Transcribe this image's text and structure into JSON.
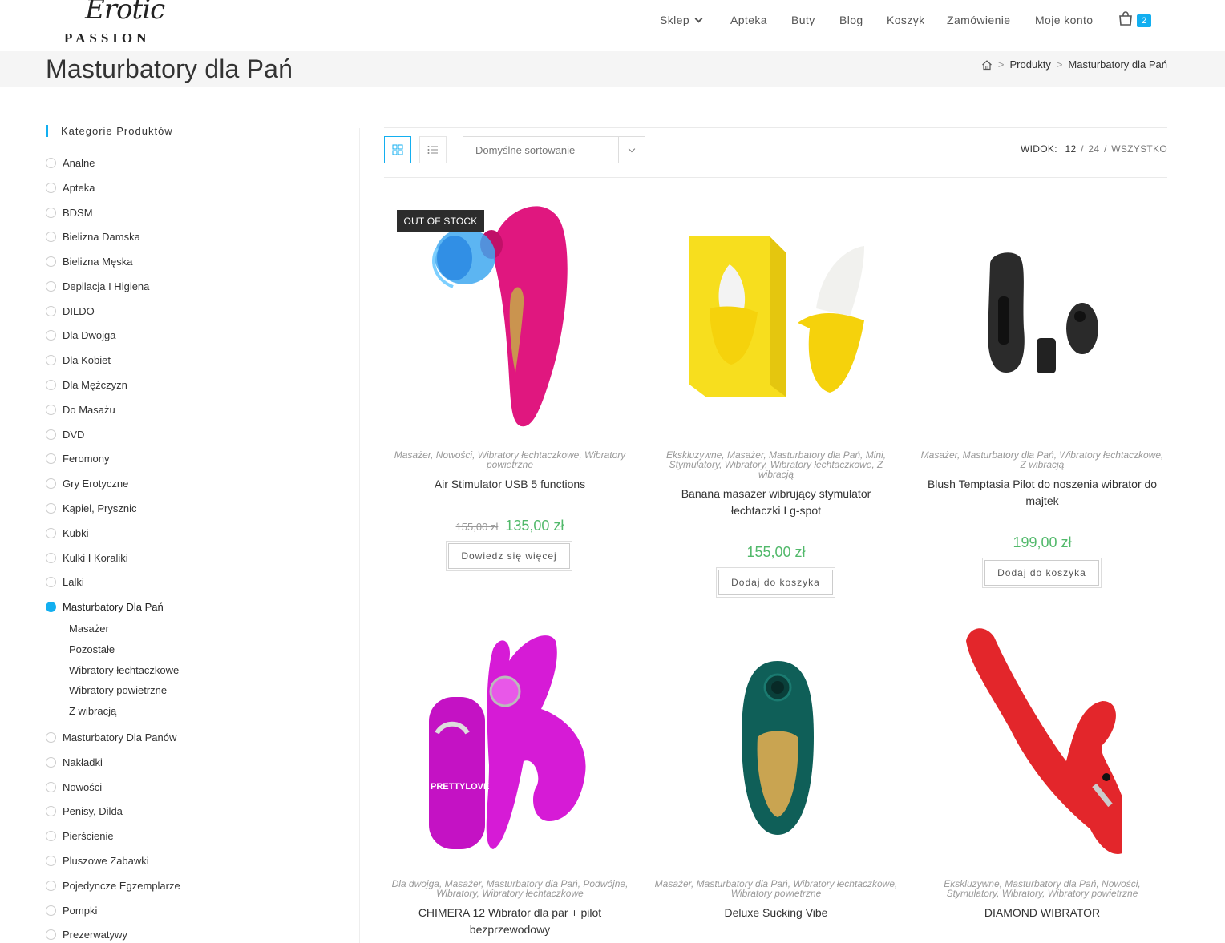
{
  "logo": {
    "script": "Erotic",
    "caps": "PASSION"
  },
  "nav": {
    "shop": "Sklep",
    "pharmacy": "Apteka",
    "shoes": "Buty",
    "blog": "Blog",
    "cart": "Koszyk",
    "order": "Zamówienie",
    "account": "Moje konto",
    "cart_count": "2"
  },
  "page": {
    "title": "Masturbatory dla Pań",
    "breadcrumb": [
      "Produkty",
      "Masturbatory dla Pań"
    ]
  },
  "sidebar": {
    "title": "Kategorie Produktów",
    "categories": [
      "Analne",
      "Apteka",
      "BDSM",
      "Bielizna Damska",
      "Bielizna Męska",
      "Depilacja I Higiena",
      "DILDO",
      "Dla Dwojga",
      "Dla Kobiet",
      "Dla Mężczyzn",
      "Do Masażu",
      "DVD",
      "Feromony",
      "Gry Erotyczne",
      "Kąpiel, Prysznic",
      "Kubki",
      "Kulki I Koraliki",
      "Lalki",
      "Masturbatory Dla Pań"
    ],
    "subcategories": [
      "Masażer",
      "Pozostałe",
      "Wibratory łechtaczkowe",
      "Wibratory powietrzne",
      "Z wibracją"
    ],
    "categories_after": [
      "Masturbatory Dla Panów",
      "Nakładki",
      "Nowości",
      "Penisy, Dilda",
      "Pierścienie",
      "Pluszowe Zabawki",
      "Pojedyncze Egzemplarze",
      "Pompki",
      "Prezerwatywy"
    ]
  },
  "toolbar": {
    "sort_label": "Domyślne sortowanie",
    "view_label": "WIDOK:",
    "view_12": "12",
    "view_24": "24",
    "view_all": "WSZYSTKO"
  },
  "products": [
    {
      "badge": "OUT OF STOCK",
      "cats_1": "Masażer, Nowości, Wibratory łechtaczkowe, Wibratory",
      "cats_2": "powietrzne",
      "name_1": "Air Stimulator USB 5 functions",
      "name_2": "",
      "old_price": "155,00 zł",
      "price": "135,00 zł",
      "button": "Dowiedz się więcej"
    },
    {
      "cats_1": "Ekskluzywne, Masażer, Masturbatory dla Pań, Mini,",
      "cats_2": "Stymulatory, Wibratory, Wibratory łechtaczkowe, Z",
      "cats_3": "wibracją",
      "name_1": "Banana masażer wibrujący stymulator",
      "name_2": "łechtaczki I g-spot",
      "price": "155,00 zł",
      "button": "Dodaj do koszyka"
    },
    {
      "cats_1": "Masażer, Masturbatory dla Pań, Wibratory łechtaczkowe,",
      "cats_2": "Z wibracją",
      "name_1": "Blush Temptasia Pilot do noszenia wibrator do",
      "name_2": "majtek",
      "price": "199,00 zł",
      "button": "Dodaj do koszyka"
    },
    {
      "cats_1": "Dla dwojga, Masażer, Masturbatory dla Pań, Podwójne,",
      "cats_2": "Wibratory, Wibratory łechtaczkowe",
      "name_1": "CHIMERA 12 Wibrator dla par + pilot",
      "name_2": "bezprzewodowy",
      "image_text": "PRETTYLOVE"
    },
    {
      "cats_1": "Masażer, Masturbatory dla Pań, Wibratory łechtaczkowe,",
      "cats_2": "Wibratory powietrzne",
      "name_1": "Deluxe Sucking Vibe"
    },
    {
      "cats_1": "Ekskluzywne, Masturbatory dla Pań, Nowości,",
      "cats_2": "Stymulatory, Wibratory, Wibratory powietrzne",
      "name_1": "DIAMOND WIBRATOR"
    }
  ],
  "colors": {
    "accent": "#13aff0",
    "price": "#52b96b",
    "magenta": "#e0177f",
    "banana_yellow": "#f7de1e"
  }
}
